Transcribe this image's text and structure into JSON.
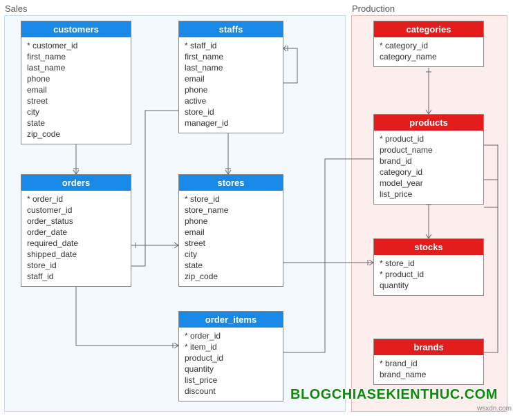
{
  "schemas": {
    "sales": {
      "label": "Sales"
    },
    "production": {
      "label": "Production"
    }
  },
  "entities": {
    "customers": {
      "title": "customers",
      "fields": [
        "* customer_id",
        "first_name",
        "last_name",
        "phone",
        "email",
        "street",
        "city",
        "state",
        "zip_code"
      ]
    },
    "staffs": {
      "title": "staffs",
      "fields": [
        "* staff_id",
        "first_name",
        "last_name",
        "email",
        "phone",
        "active",
        "store_id",
        "manager_id"
      ]
    },
    "categories": {
      "title": "categories",
      "fields": [
        "* category_id",
        "category_name"
      ]
    },
    "orders": {
      "title": "orders",
      "fields": [
        "* order_id",
        "customer_id",
        "order_status",
        "order_date",
        "required_date",
        "shipped_date",
        "store_id",
        "staff_id"
      ]
    },
    "stores": {
      "title": "stores",
      "fields": [
        "* store_id",
        "store_name",
        "phone",
        "email",
        "street",
        "city",
        "state",
        "zip_code"
      ]
    },
    "products": {
      "title": "products",
      "fields": [
        "* product_id",
        "product_name",
        "brand_id",
        "category_id",
        "model_year",
        "list_price"
      ]
    },
    "order_items": {
      "title": "order_items",
      "fields": [
        "* order_id",
        "* item_id",
        "product_id",
        "quantity",
        "list_price",
        "discount"
      ]
    },
    "stocks": {
      "title": "stocks",
      "fields": [
        "* store_id",
        "* product_id",
        "quantity"
      ]
    },
    "brands": {
      "title": "brands",
      "fields": [
        "* brand_id",
        "brand_name"
      ]
    }
  },
  "watermark": {
    "main": "BLOGCHIASEKIENTHUC.COM",
    "small": "wsxdn.com"
  }
}
